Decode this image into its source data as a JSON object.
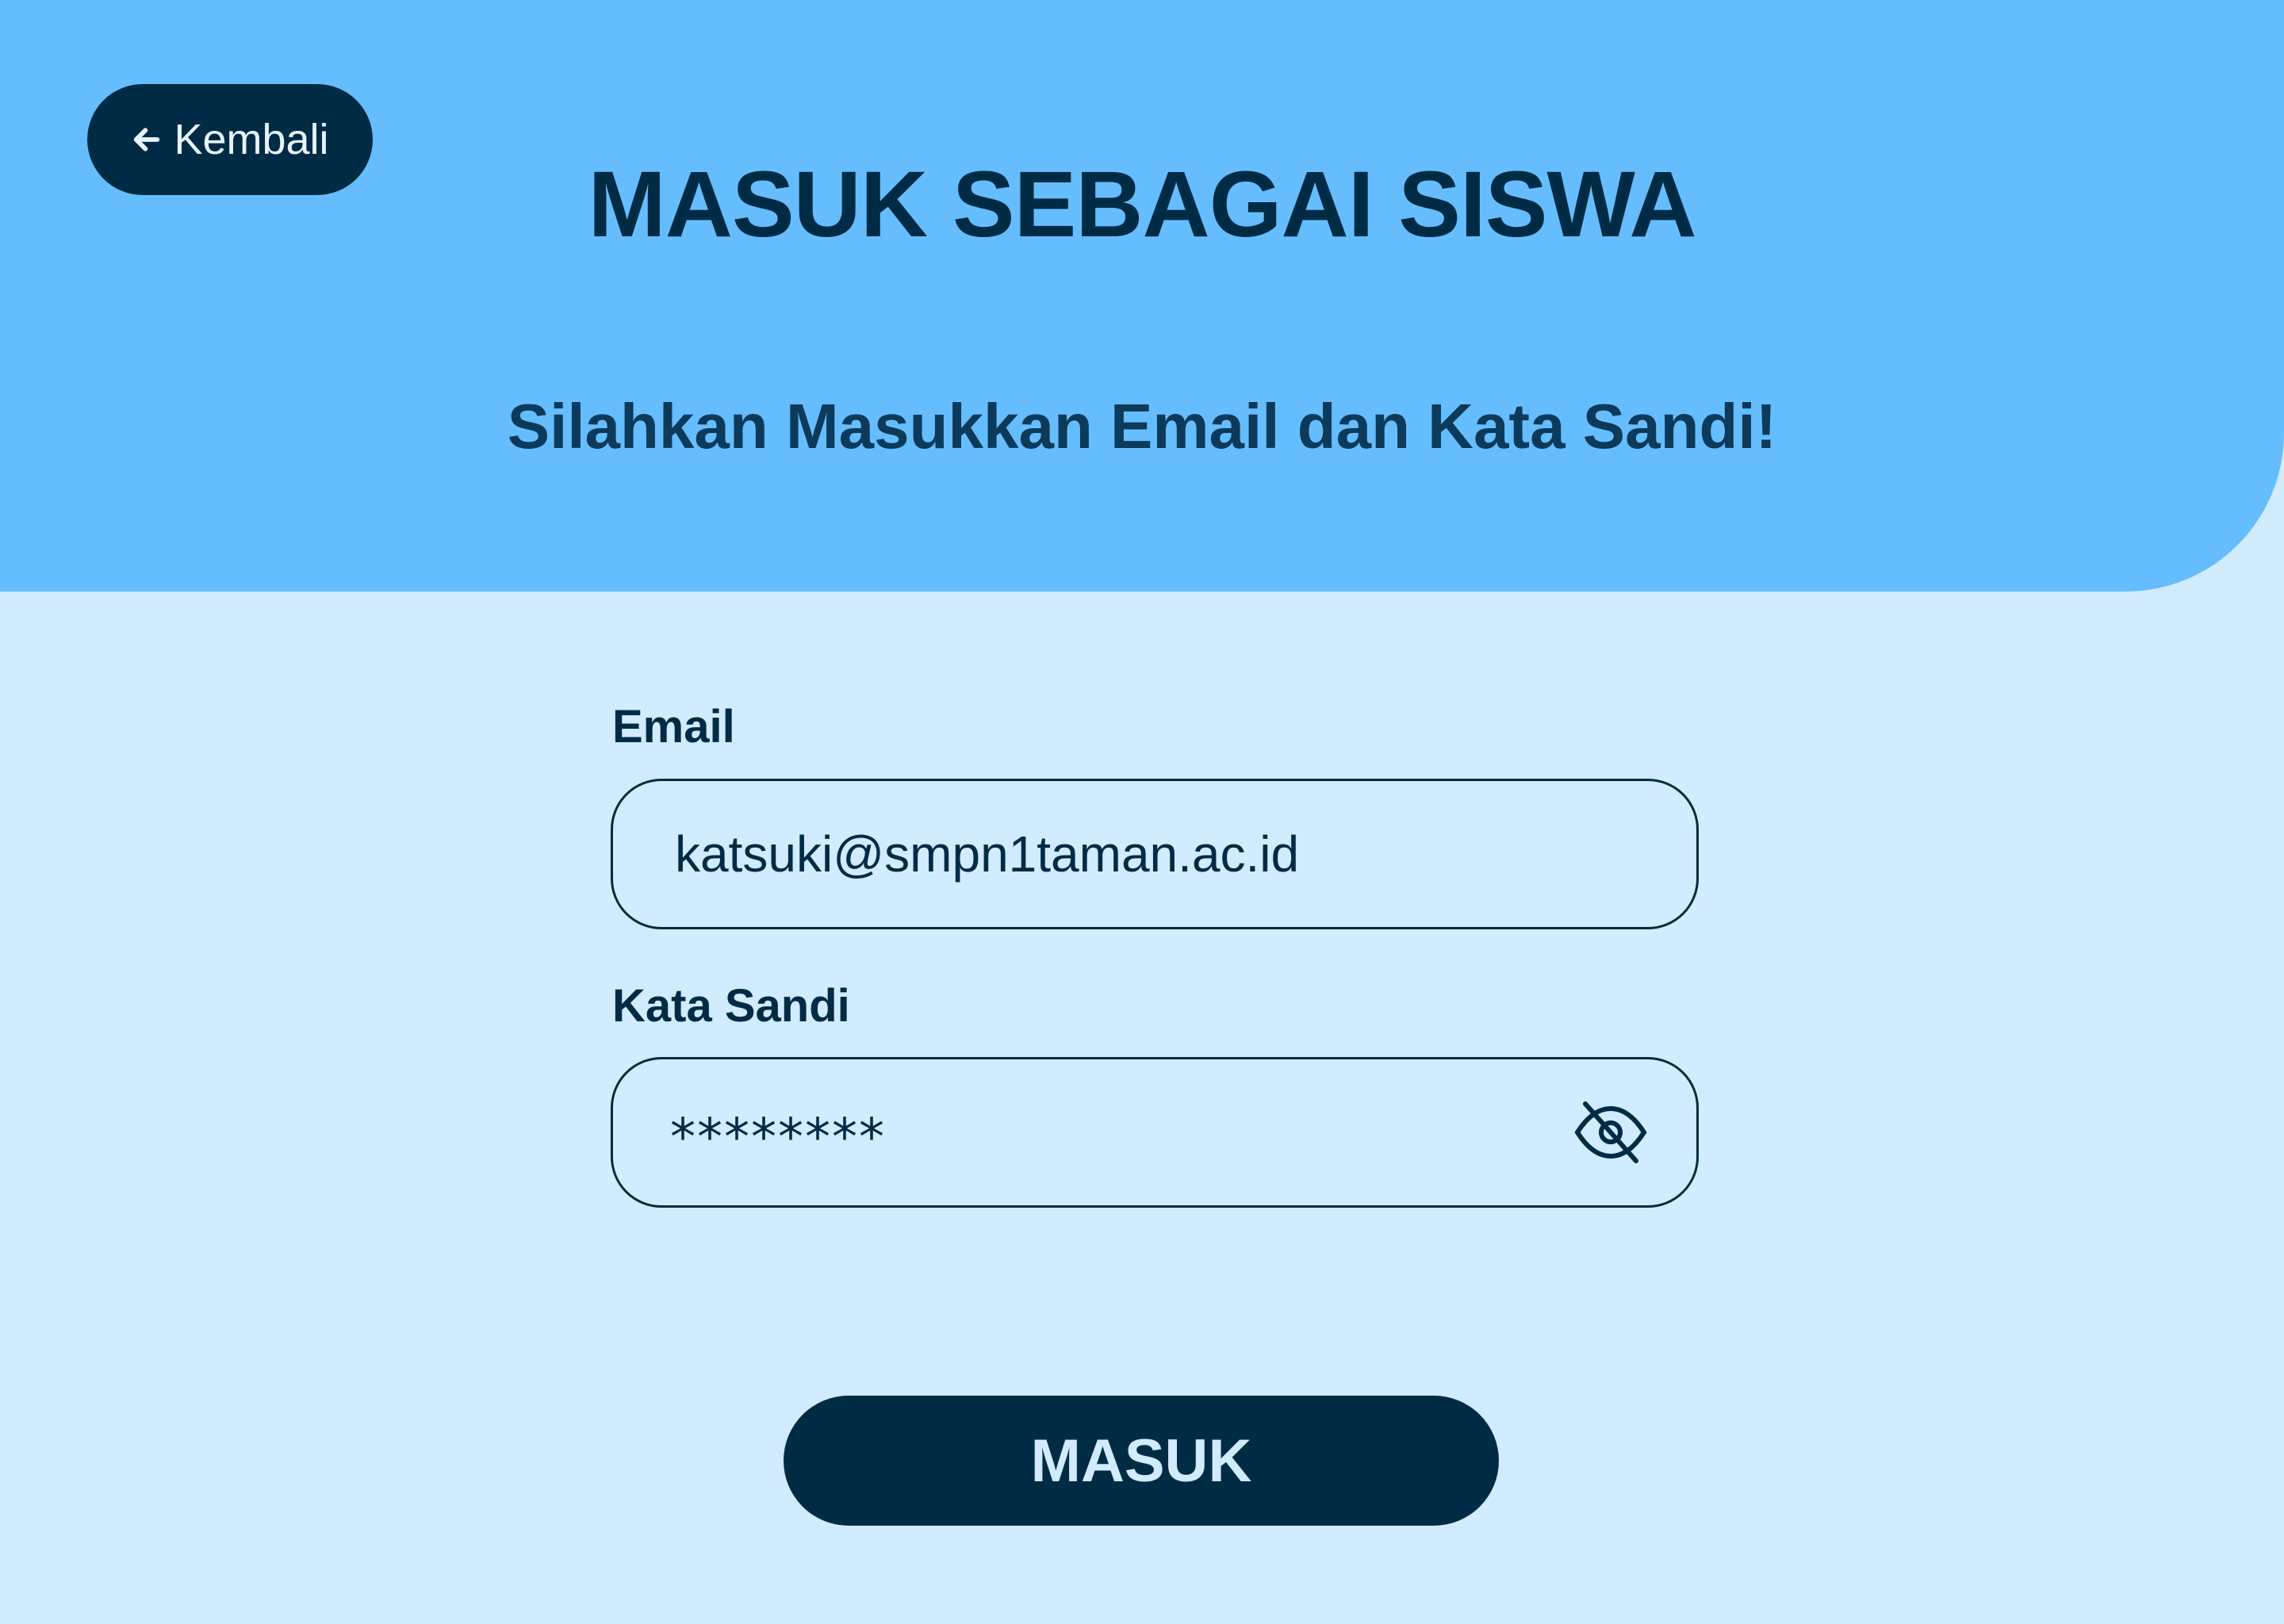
{
  "header": {
    "back_label": "Kembali",
    "back_icon": "arrow-left-icon",
    "title": "MASUK SEBAGAI SISWA",
    "subtitle": "Silahkan Masukkan Email dan Kata Sandi!"
  },
  "form": {
    "email_label": "Email",
    "email_value": "katsuki@smpn1taman.ac.id",
    "password_label": "Kata Sandi",
    "password_value": "********",
    "password_toggle_icon": "eye-slash-icon",
    "submit_label": "MASUK"
  },
  "colors": {
    "header_bg": "#66bdfd",
    "page_bg": "#d1ebff",
    "primary_dark": "#002b45"
  }
}
